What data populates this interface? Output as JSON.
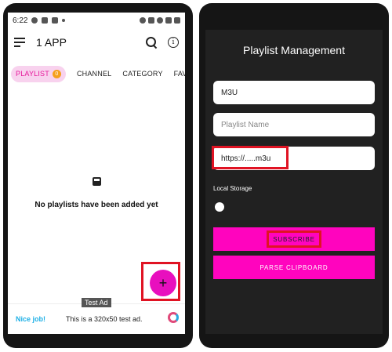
{
  "left": {
    "status_time": "6:22",
    "app_title": "1 APP",
    "tabs": [
      {
        "label": "PLAYLIST",
        "badge": "0"
      },
      {
        "label": "CHANNEL"
      },
      {
        "label": "CATEGORY"
      },
      {
        "label": "FAVORITES"
      }
    ],
    "empty_message": "No playlists have been added yet",
    "fab_icon": "+",
    "ad": {
      "tag": "Test Ad",
      "brand": "Nice job!",
      "text": "This is a 320x50 test ad."
    }
  },
  "right": {
    "title": "Playlist Management",
    "type_value": "M3U",
    "name_placeholder": "Playlist Name",
    "url_value": "https://.....m3u",
    "local_storage_label": "Local Storage",
    "subscribe_label": "SUBSCRIBE",
    "parse_label": "PARSE CLIPBOARD"
  },
  "colors": {
    "accent_pink": "#ff04be",
    "highlight_red": "#e01323",
    "dark_bg": "#212121"
  }
}
